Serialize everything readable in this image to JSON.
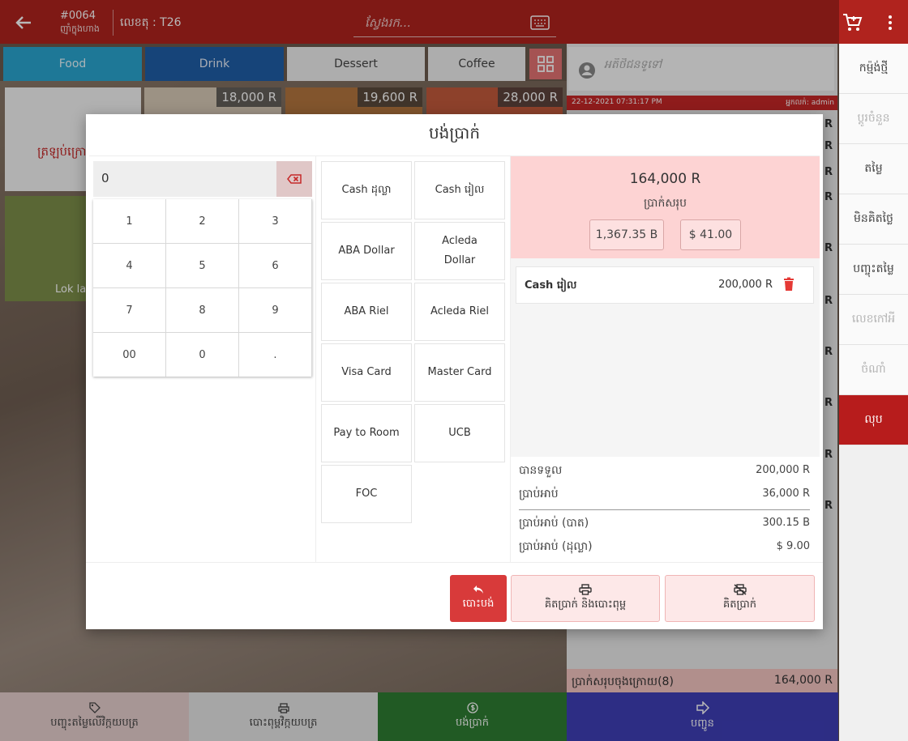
{
  "topbar": {
    "order_no": "#0064",
    "order_sub": "ញ៉ាំក្នុងហាង",
    "table_label": "លេខតុ : T26",
    "search_placeholder": "ស្វែងរក..."
  },
  "categories": [
    "Food",
    "Drink",
    "Dessert",
    "Coffee"
  ],
  "products": {
    "back_label": "ត្រឡប់ក្រោយ",
    "prices": [
      "18,000 R",
      "19,600 R",
      "28,000 R"
    ],
    "label": "Lok la"
  },
  "order": {
    "customer_placeholder": "អតិថិជនទូទៅ",
    "timestamp": "22-12-2021 07:31:17 PM",
    "seller": "អ្នកលក់: admin",
    "currency_mark": "R",
    "grand_total_label": "ប្រាក់សរុបចុងក្រោយ(8)",
    "grand_total_value": "164,000 R"
  },
  "side_menu": [
    "កម្ម៉ង់ថ្មី",
    "ប្តូរចំនួន",
    "តម្លៃ",
    "មិនគិតថ្លៃ",
    "បញ្ចុះតម្លៃ",
    "លេខកៅអី",
    "ចំណាំ",
    "លុប"
  ],
  "bottom": {
    "discount": "បញ្ចុះតម្លៃលើវិក្កយបត្រ",
    "print": "បោះពុម្ពវិក្កយបត្រ",
    "pay": "បង់ប្រាក់",
    "send": "បញ្ជូន"
  },
  "modal": {
    "title": "បង់ប្រាក់",
    "amount_value": "0",
    "keys": [
      "1",
      "2",
      "3",
      "4",
      "5",
      "6",
      "7",
      "8",
      "9",
      "00",
      "0",
      "."
    ],
    "methods": [
      "Cash ដុល្លា",
      "Cash រៀល",
      "ABA Dollar",
      "Acleda Dollar",
      "ABA Riel",
      "Acleda Riel",
      "Visa Card",
      "Master Card",
      "Pay to Room",
      "UCB",
      "FOC"
    ],
    "total_amount": "164,000 R",
    "total_label": "ប្រាក់សរុប",
    "total_baht": "1,367.35 B",
    "total_usd": "$ 41.00",
    "payments": [
      {
        "name": "Cash រៀល",
        "value": "200,000 R"
      }
    ],
    "received_label": "បានទទួល",
    "received_value": "200,000 R",
    "change_label": "ប្រាប់អាប់",
    "change_value": "36,000 R",
    "change_baht_label": "ប្រាប់អាប់ (បាត)",
    "change_baht_value": "300.15 B",
    "change_usd_label": "ប្រាប់អាប់ (ដុល្លា)",
    "change_usd_value": "$ 9.00",
    "btn_cancel": "បោះបង់",
    "btn_print_close": "គិតប្រាក់ និងបោះពុម្ព",
    "btn_pay": "គិតប្រាក់"
  },
  "colors": {
    "brand_red": "#b0231e",
    "food": "#2aa7d1",
    "drink": "#1f5fa8",
    "pay_green": "#2e7d32",
    "send_blue": "#3f3fb8",
    "total_pink": "#fdd3d3"
  }
}
